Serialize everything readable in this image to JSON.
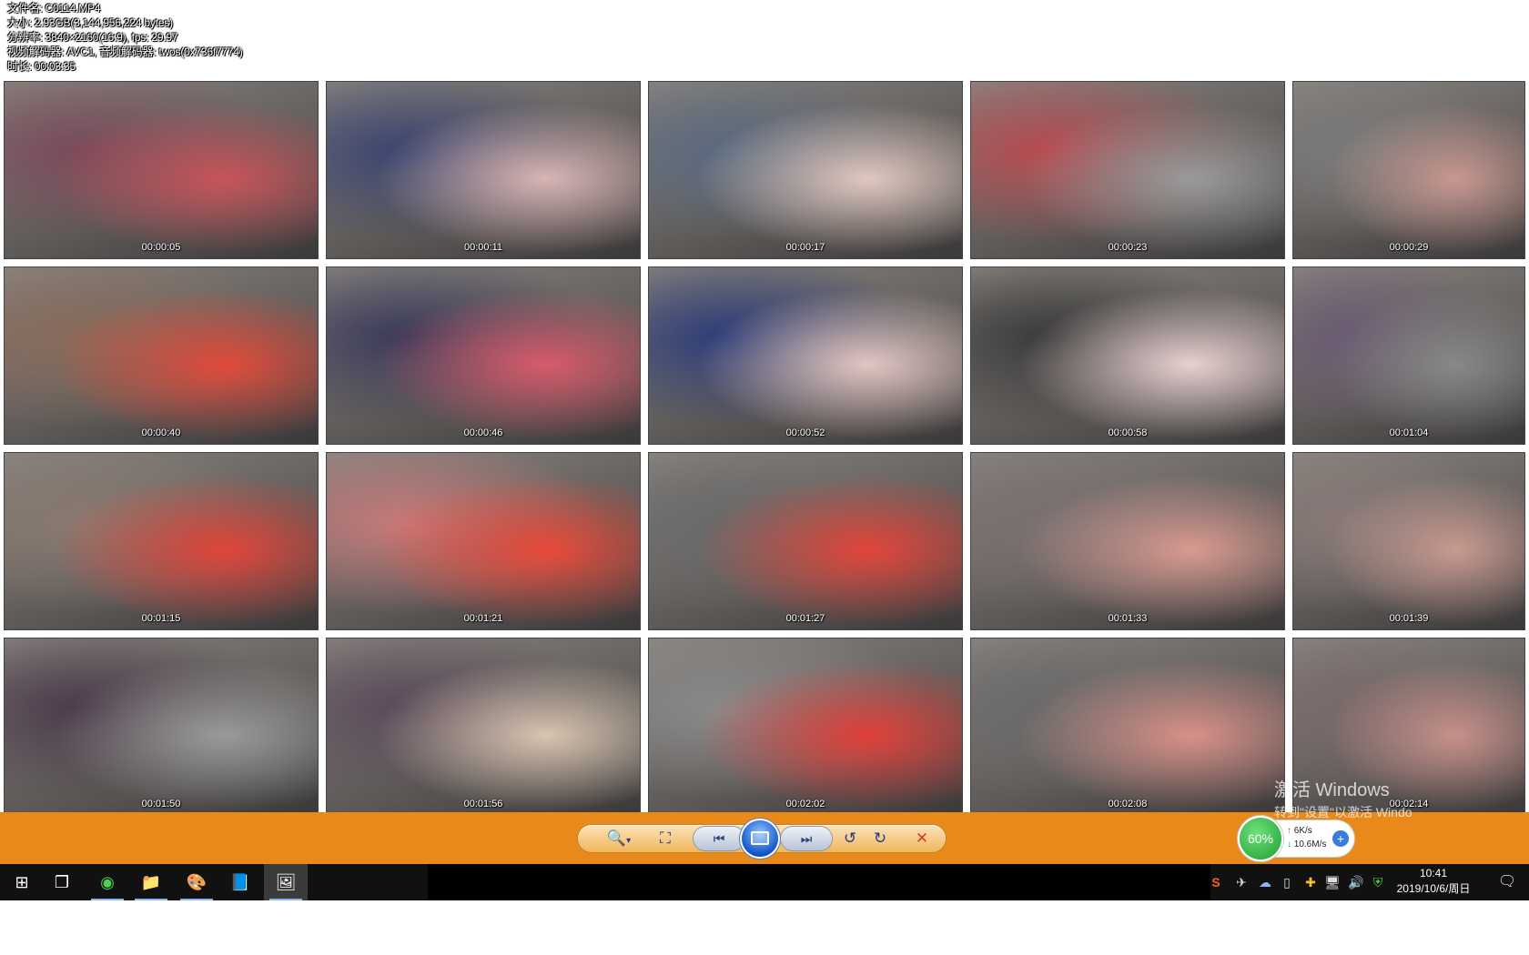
{
  "file_info": {
    "filename": "文件名: C0114.MP4",
    "size": "大小: 2.93GB(3,144,956,224 bytes)",
    "resolution": "分辨率: 3840×2160(16:9), fps: 29.97",
    "codecs": "视频解码器: AVC1, 音频解码器: twos(0x736f7774)",
    "duration": "时长: 00:03:35"
  },
  "thumbnails": [
    {
      "time": "00:00:05",
      "c1": "#7a4a5a",
      "c2": "#c7545a"
    },
    {
      "time": "00:00:11",
      "c1": "#3a4470",
      "c2": "#d8b4b4"
    },
    {
      "time": "00:00:17",
      "c1": "#5a6a80",
      "c2": "#e0c8c0"
    },
    {
      "time": "00:00:23",
      "c1": "#b84a50",
      "c2": "#9a9a9a"
    },
    {
      "time": "00:00:29",
      "c1": "#7a7a7a",
      "c2": "#c89890"
    },
    {
      "time": "00:00:40",
      "c1": "#8a6a5a",
      "c2": "#e04b3b"
    },
    {
      "time": "00:00:46",
      "c1": "#3a3a5a",
      "c2": "#d85a6a"
    },
    {
      "time": "00:00:52",
      "c1": "#2c3c78",
      "c2": "#e2c6c2"
    },
    {
      "time": "00:00:58",
      "c1": "#3a3a3a",
      "c2": "#e8d0d0"
    },
    {
      "time": "00:01:04",
      "c1": "#6a5a72",
      "c2": "#888888"
    },
    {
      "time": "00:01:15",
      "c1": "#8a7a70",
      "c2": "#e0453a"
    },
    {
      "time": "00:01:21",
      "c1": "#c87a7a",
      "c2": "#e84a3a"
    },
    {
      "time": "00:01:27",
      "c1": "#6a6a6a",
      "c2": "#e2453a"
    },
    {
      "time": "00:01:33",
      "c1": "#7a7070",
      "c2": "#d89a90"
    },
    {
      "time": "00:01:39",
      "c1": "#8a7a78",
      "c2": "#c89a90"
    },
    {
      "time": "00:01:50",
      "c1": "#4a3a4a",
      "c2": "#9a9a9a"
    },
    {
      "time": "00:01:56",
      "c1": "#5a4a5a",
      "c2": "#d8c4b0"
    },
    {
      "time": "00:02:02",
      "c1": "#8a8a8a",
      "c2": "#e0403a"
    },
    {
      "time": "00:02:08",
      "c1": "#6a6a6a",
      "c2": "#d89088"
    },
    {
      "time": "00:02:14",
      "c1": "#7a6a6a",
      "c2": "#c8908a"
    }
  ],
  "toolbar": {
    "zoom_icon": "🔍",
    "zoom_caret": "▾",
    "fit_icon": "⛶",
    "prev_icon": "⏮",
    "next_icon": "⏭",
    "rotate_left_icon": "↺",
    "rotate_right_icon": "↻",
    "close_icon": "✕"
  },
  "watermark": {
    "line1": "激活 Windows",
    "line2": "转到\"设置\"以激活 Windo"
  },
  "net_widget": {
    "percent": "60%",
    "up_arrow": "↑",
    "down_arrow": "↓",
    "up_speed": "6K/s",
    "down_speed": "10.6M/s",
    "plus": "+"
  },
  "taskbar": {
    "start_icon": "⊞",
    "taskview_icon": "❐",
    "browser_icon": "◉",
    "explorer_icon": "📁",
    "paint_icon": "🎨",
    "notes_icon": "📘",
    "viewer_icon": "🖼"
  },
  "tray": {
    "sogou_icon": "S",
    "network_off_icon": "✈",
    "cloud_icon": "☁",
    "usb_icon": "▯",
    "add_icon": "✚",
    "monitor_icon": "🖥",
    "volume_icon": "🔊",
    "shield_icon": "⛨",
    "time": "10:41",
    "date": "2019/10/6/周日",
    "notification_icon": "🗨"
  },
  "colors": {
    "toolbar_orange": "#e8891a",
    "taskbar": "#111111",
    "accent_blue": "#1456c9",
    "close_red": "#d83a2a"
  }
}
